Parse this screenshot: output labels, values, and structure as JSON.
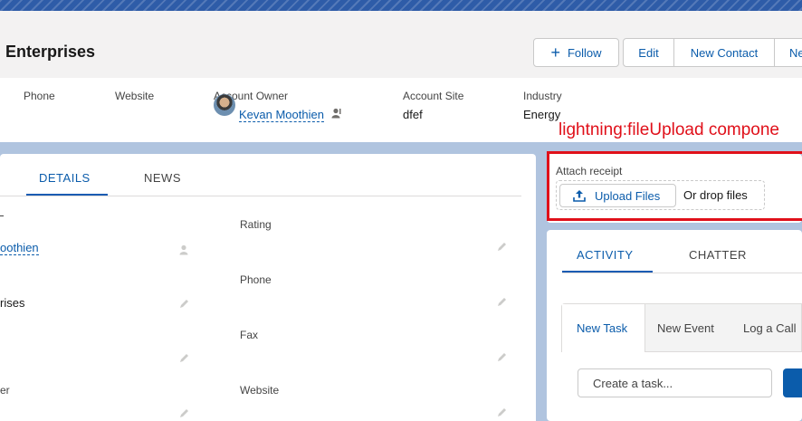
{
  "header": {
    "title": "Enterprises",
    "buttons": {
      "follow": "Follow",
      "edit": "Edit",
      "new_contact": "New Contact",
      "more": "Ne"
    }
  },
  "highlights": {
    "phone_label": "Phone",
    "website_label": "Website",
    "owner_label": "Account Owner",
    "owner_value": "Kevan Moothien",
    "site_label": "Account Site",
    "site_value": "dfef",
    "industry_label": "Industry",
    "industry_value": "Energy"
  },
  "annotation": "lightning:fileUpload compone",
  "details": {
    "tabs": [
      "DETAILS",
      "NEWS"
    ],
    "left_values": [
      "oothien",
      "rises"
    ],
    "left_label_bottom": "er",
    "right_labels": [
      "Rating",
      "Phone",
      "Fax",
      "Website"
    ]
  },
  "upload": {
    "label": "Attach receipt",
    "button": "Upload Files",
    "drop_text": "Or drop files"
  },
  "activity": {
    "tabs": [
      "ACTIVITY",
      "CHATTER"
    ],
    "sub_tabs": [
      "New Task",
      "New Event",
      "Log a Call"
    ],
    "task_placeholder": "Create a task..."
  },
  "colors": {
    "brand": "#0b5cab",
    "annotation_red": "#e0101a",
    "banner": "#2e5ca8"
  }
}
